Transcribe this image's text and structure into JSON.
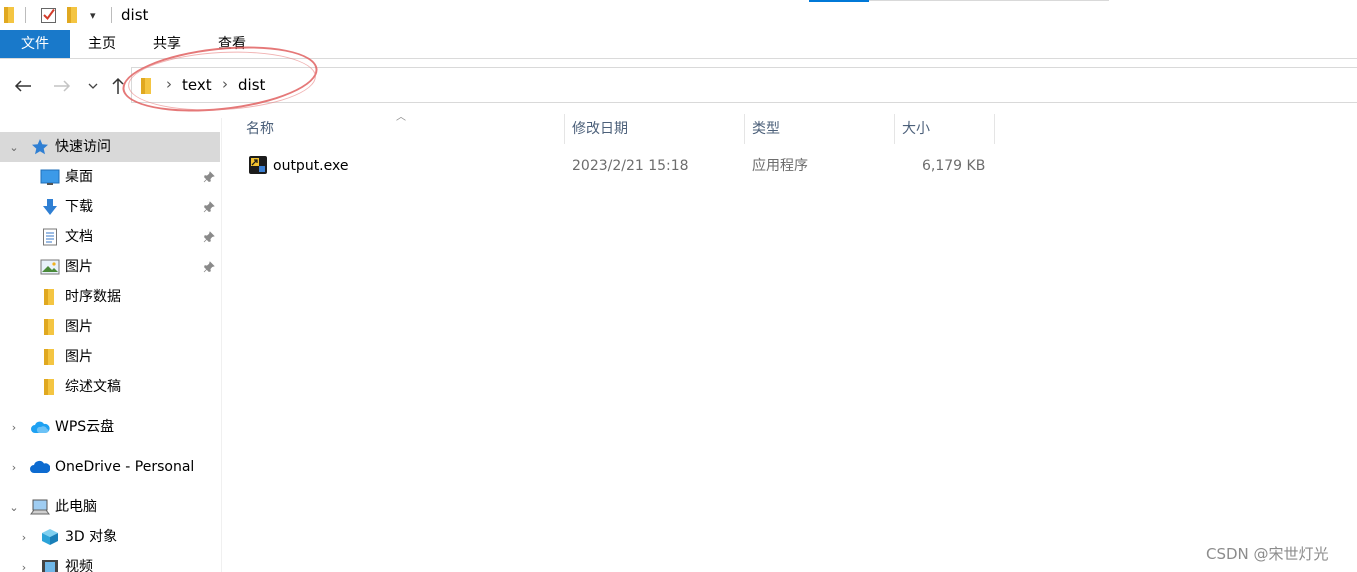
{
  "window": {
    "title": "dist"
  },
  "ribbon": {
    "tabs": [
      {
        "label": "文件"
      },
      {
        "label": "主页"
      },
      {
        "label": "共享"
      },
      {
        "label": "查看"
      }
    ]
  },
  "address": {
    "crumbs": [
      "text",
      "dist"
    ]
  },
  "sidebar": {
    "quick_access": "快速访问",
    "items": [
      {
        "label": "桌面",
        "pinned": true
      },
      {
        "label": "下载",
        "pinned": true
      },
      {
        "label": "文档",
        "pinned": true
      },
      {
        "label": "图片",
        "pinned": true
      },
      {
        "label": "时序数据",
        "pinned": false
      },
      {
        "label": "图片",
        "pinned": false
      },
      {
        "label": "图片",
        "pinned": false
      },
      {
        "label": "综述文稿",
        "pinned": false
      }
    ],
    "wps_cloud": "WPS云盘",
    "onedrive": "OneDrive - Personal",
    "this_pc": "此电脑",
    "objects_3d": "3D 对象",
    "videos": "视频"
  },
  "columns": {
    "name": "名称",
    "modified": "修改日期",
    "type": "类型",
    "size": "大小"
  },
  "files": [
    {
      "name": "output.exe",
      "modified": "2023/2/21 15:18",
      "type": "应用程序",
      "size": "6,179 KB"
    }
  ],
  "watermark": "CSDN @宋世灯光",
  "colors": {
    "accent": "#1979ca",
    "selected": "#d9d9d9",
    "folder": "#f4c542",
    "annotation": "#e06060"
  }
}
